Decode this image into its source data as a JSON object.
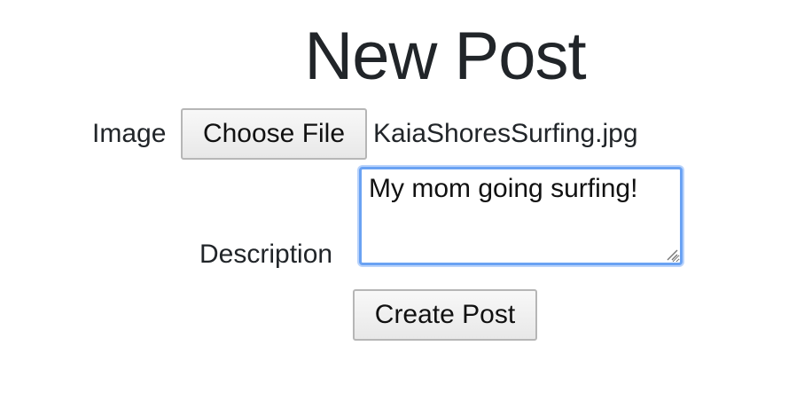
{
  "page": {
    "title": "New Post"
  },
  "form": {
    "image_label": "Image",
    "file_button_label": "Choose File",
    "file_name": "KaiaShoresSurfing.jpg",
    "description_label": "Description",
    "description_value": "My mom going surfing!",
    "submit_label": "Create Post"
  },
  "colors": {
    "text": "#212529",
    "focus_border": "#6aa2f3",
    "button_border": "#b6b6b6"
  }
}
